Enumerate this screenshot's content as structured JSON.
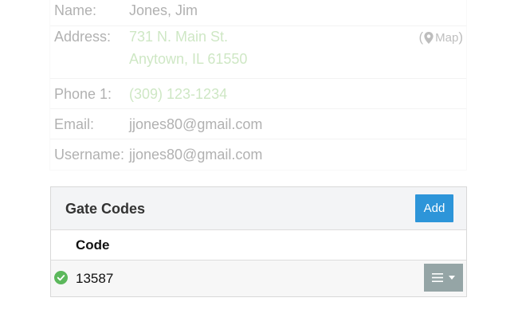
{
  "contact": {
    "name_label": "Name:",
    "name_value": "Jones, Jim",
    "address_label": "Address:",
    "address_line1": "731 N. Main St.",
    "address_line2": "Anytown, IL 61550",
    "map_open": "(",
    "map_label": "Map",
    "map_close": ")",
    "phone_label": "Phone 1:",
    "phone_value": "(309) 123-1234",
    "email_label": "Email:",
    "email_value": "jjones80@gmail.com",
    "username_label": "Username:",
    "username_value": "jjones80@gmail.com"
  },
  "gate_codes": {
    "title": "Gate Codes",
    "add_label": "Add",
    "column_header": "Code",
    "rows": [
      {
        "code": "13587",
        "status": "active"
      }
    ]
  },
  "colors": {
    "add_button": "#2d95d9",
    "menu_button": "#95a5a6",
    "check": "#5cb85c",
    "link": "#7fc267"
  },
  "icons": {
    "map": "map-marker-icon",
    "status": "check-circle-icon",
    "menu": "bars-icon",
    "caret": "caret-down-icon"
  }
}
